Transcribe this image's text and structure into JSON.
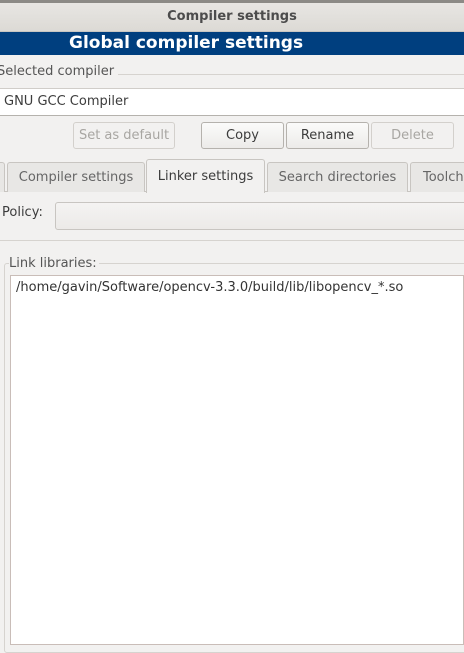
{
  "window": {
    "title": "Compiler settings"
  },
  "header": {
    "title": "Global compiler settings"
  },
  "selected_compiler": {
    "label": "Selected compiler",
    "value": "GNU GCC Compiler"
  },
  "buttons": {
    "set_default": "Set as default",
    "copy": "Copy",
    "rename": "Rename",
    "delete": "Delete"
  },
  "tabs": [
    {
      "label": "Compiler settings"
    },
    {
      "label": "Linker settings",
      "active": true
    },
    {
      "label": "Search directories"
    },
    {
      "label": "Toolchain executables"
    }
  ],
  "policy": {
    "label": "Policy:",
    "value": ""
  },
  "link_libraries": {
    "label": "Link libraries:",
    "items": [
      "/home/gavin/Software/opencv-3.3.0/build/lib/libopencv_*.so"
    ]
  },
  "colors": {
    "header_bg": "#003f7f"
  }
}
